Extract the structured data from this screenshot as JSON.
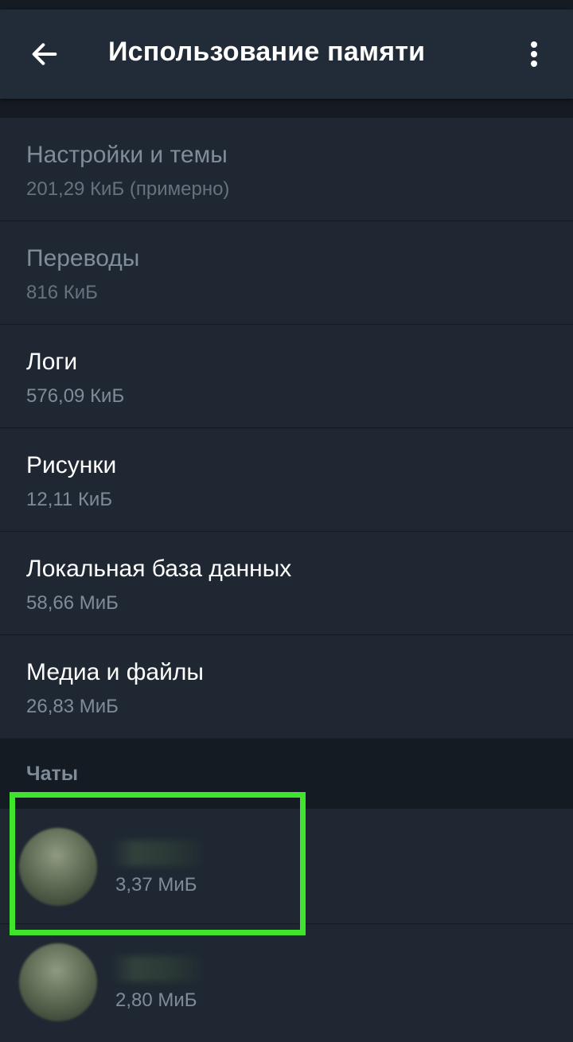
{
  "header": {
    "title": "Использование памяти",
    "back_icon": "arrow-left-icon",
    "menu_icon": "more-vertical-icon"
  },
  "storage_items": [
    {
      "title": "Настройки и темы",
      "size": "201,29 КиБ (примерно)"
    },
    {
      "title": "Переводы",
      "size": "816 КиБ"
    },
    {
      "title": "Логи",
      "size": "576,09 КиБ"
    },
    {
      "title": "Рисунки",
      "size": "12,11 КиБ"
    },
    {
      "title": "Локальная база данных",
      "size": "58,66 МиБ"
    },
    {
      "title": "Медиа и файлы",
      "size": "26,83 МиБ"
    }
  ],
  "chats_section": {
    "label": "Чаты",
    "items": [
      {
        "size": "3,37 МиБ"
      },
      {
        "size": "2,80 МиБ"
      }
    ]
  },
  "colors": {
    "app_bar": "#222c38",
    "background": "#1a2129",
    "highlight": "#3ee52c"
  }
}
